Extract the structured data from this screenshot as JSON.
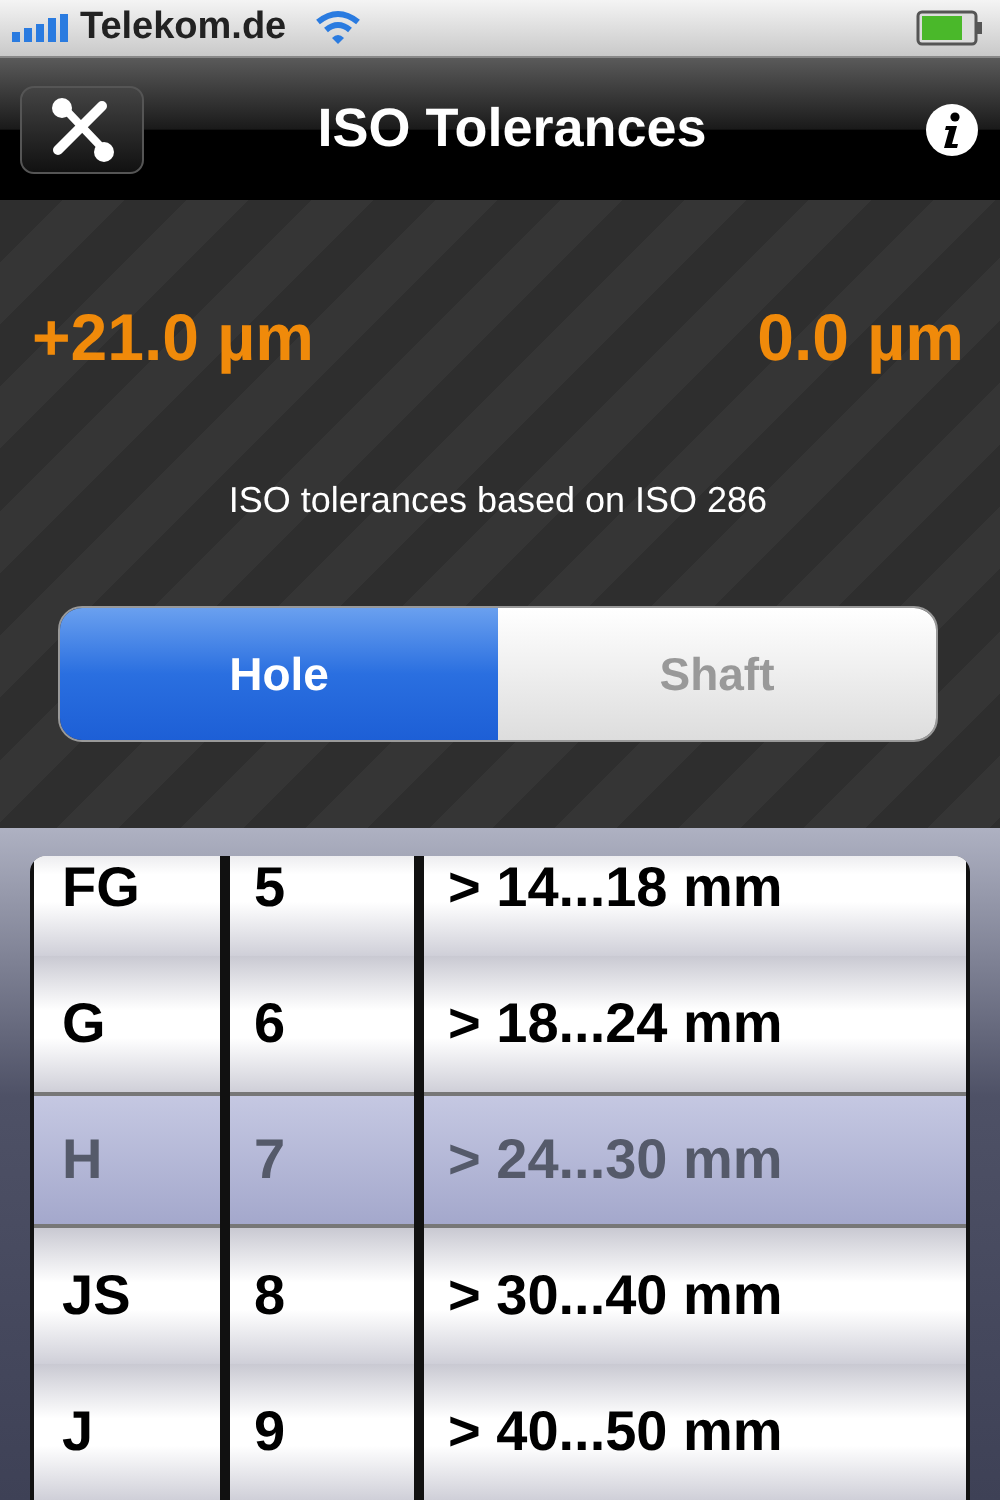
{
  "status_bar": {
    "carrier": "Telekom.de"
  },
  "nav_bar": {
    "title": "ISO Tolerances"
  },
  "readouts": [
    "+21.0 µm",
    "0.0 µm"
  ],
  "note": "ISO tolerances based on ISO 286",
  "segments": [
    {
      "label": "Hole",
      "selected": true
    },
    {
      "label": "Shaft",
      "selected": false
    }
  ],
  "picker": {
    "wheels": [
      {
        "items": [
          {
            "label": "FG",
            "selected": false
          },
          {
            "label": "G",
            "selected": false
          },
          {
            "label": "H",
            "selected": true
          },
          {
            "label": "JS",
            "selected": false
          },
          {
            "label": "J",
            "selected": false
          }
        ]
      },
      {
        "items": [
          {
            "label": "5",
            "selected": false
          },
          {
            "label": "6",
            "selected": false
          },
          {
            "label": "7",
            "selected": true
          },
          {
            "label": "8",
            "selected": false
          },
          {
            "label": "9",
            "selected": false
          }
        ]
      },
      {
        "items": [
          {
            "label": "> 14...18 mm",
            "selected": false
          },
          {
            "label": "> 18...24 mm",
            "selected": false
          },
          {
            "label": "> 24...30 mm",
            "selected": true
          },
          {
            "label": "> 30...40 mm",
            "selected": false
          },
          {
            "label": "> 40...50 mm",
            "selected": false
          }
        ]
      }
    ]
  }
}
